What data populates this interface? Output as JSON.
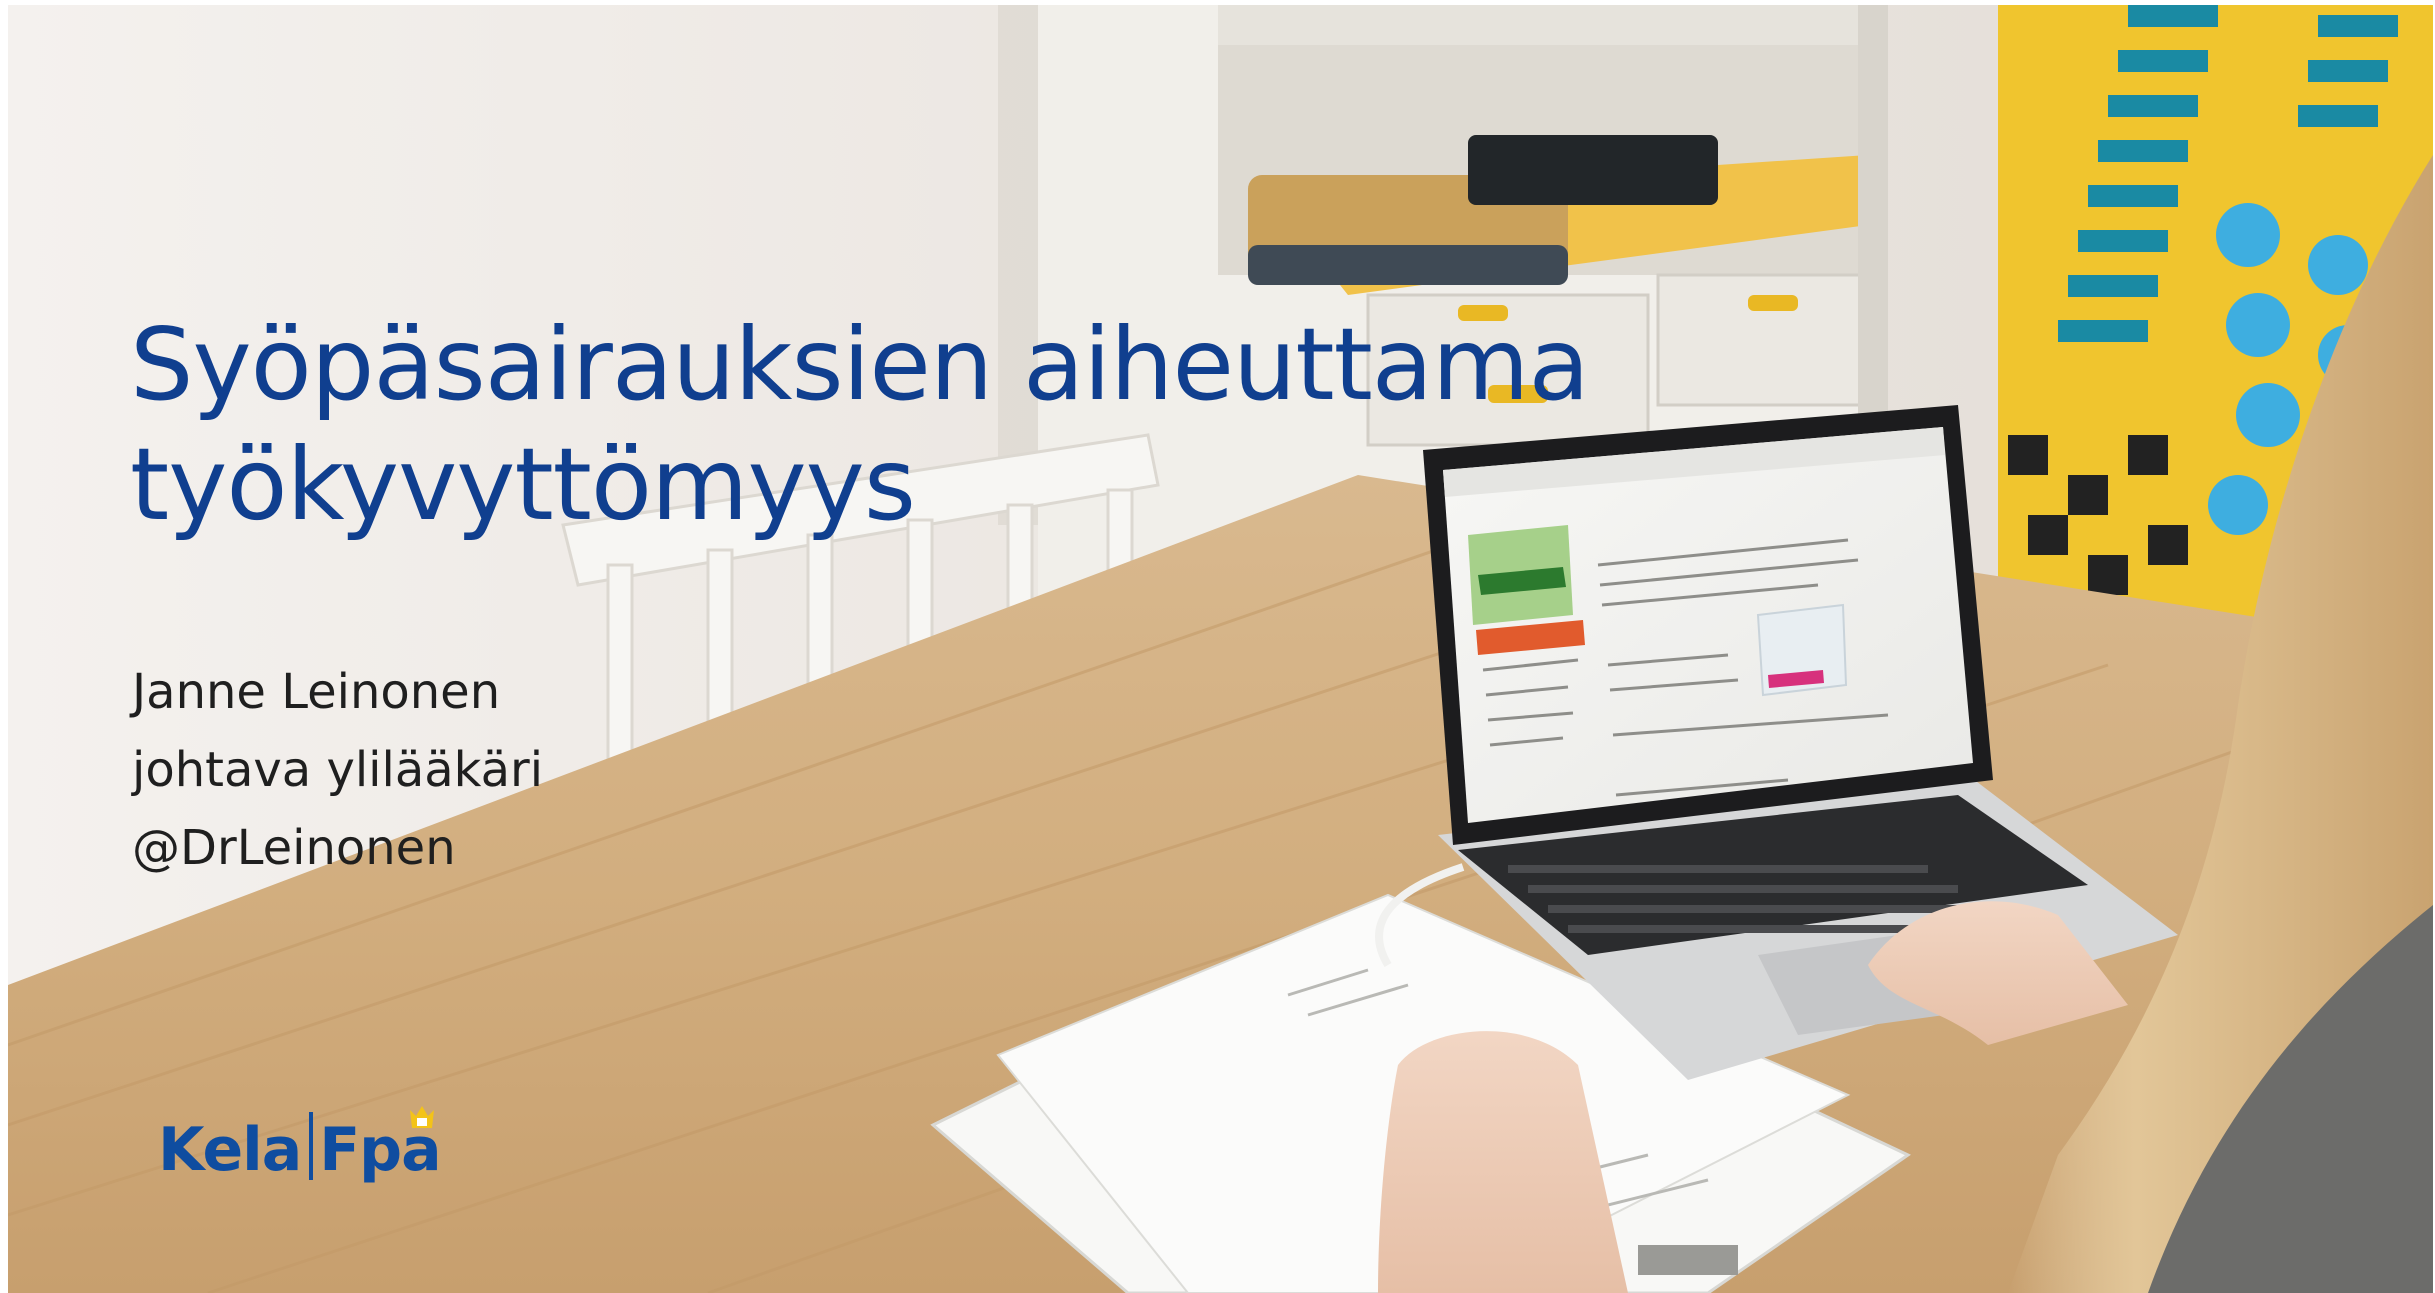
{
  "slide": {
    "title_lines": [
      "Syöpäsairauksien aiheuttama",
      "työkyvyttömyys"
    ],
    "author": {
      "name": "Janne Leinonen",
      "role": "johtava ylilääkäri",
      "handle": "@DrLeinonen"
    },
    "logo": {
      "left": "Kela",
      "right": "Fpa"
    }
  },
  "colors": {
    "title": "#103f8f",
    "text": "#1f1f1f",
    "brand": "#0f4da0",
    "brand_accent": "#f3c318"
  },
  "icons": {
    "logo_mark": "crown-icon"
  }
}
